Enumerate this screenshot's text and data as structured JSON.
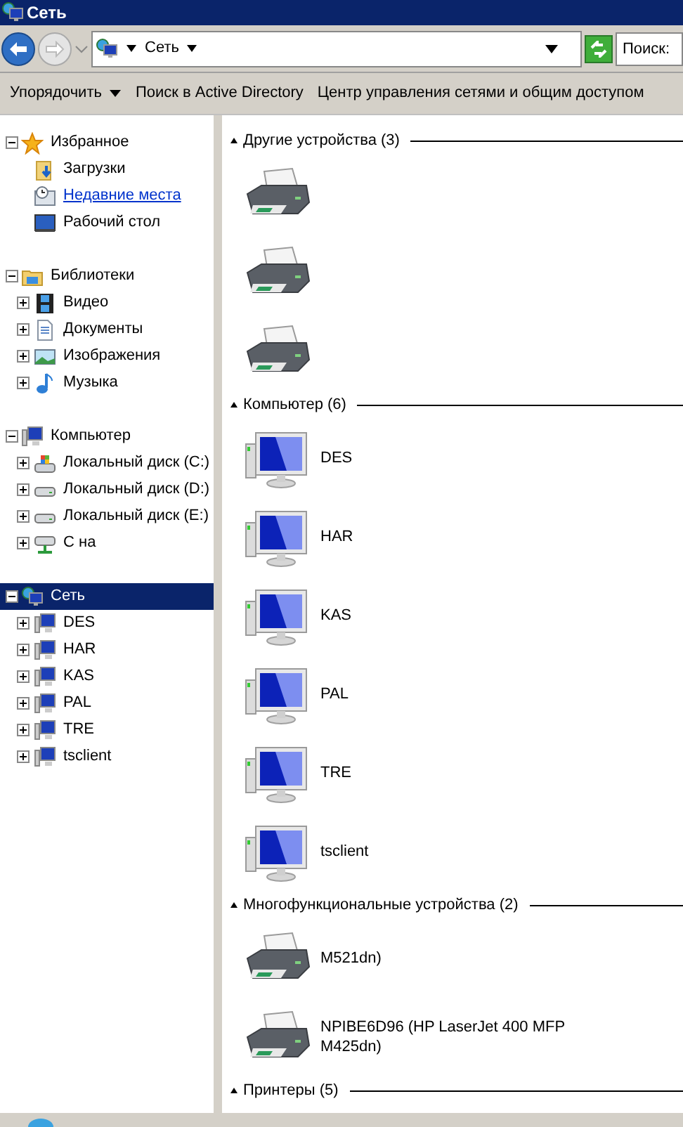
{
  "window": {
    "title": "Сеть"
  },
  "address": {
    "path": "Сеть",
    "search_placeholder": "Поиск:"
  },
  "toolbar": [
    {
      "label": "Упорядочить",
      "dropdown": true
    },
    {
      "label": "Поиск в Active Directory",
      "dropdown": false
    },
    {
      "label": "Центр управления сетями и общим доступом",
      "dropdown": false
    }
  ],
  "sidebar": {
    "groups": [
      {
        "label": "Избранное",
        "kind": "star",
        "expanded": true,
        "selected": false,
        "children": [
          {
            "label": "Загрузки",
            "kind": "downloads",
            "hovered": false
          },
          {
            "label": "Недавние места",
            "kind": "recent",
            "hovered": true
          },
          {
            "label": "Рабочий стол",
            "kind": "desktop",
            "hovered": false
          }
        ]
      },
      {
        "label": "Библиотеки",
        "kind": "library",
        "expanded": true,
        "selected": false,
        "children": [
          {
            "label": "Видео",
            "kind": "film",
            "expanded": false
          },
          {
            "label": "Документы",
            "kind": "document",
            "expanded": false
          },
          {
            "label": "Изображения",
            "kind": "image",
            "expanded": false
          },
          {
            "label": "Музыка",
            "kind": "music",
            "expanded": false
          }
        ]
      },
      {
        "label": "Компьютер",
        "kind": "computer",
        "expanded": true,
        "selected": false,
        "children": [
          {
            "label": "Локальный диск (C:)",
            "kind": "drive-win",
            "expanded": false
          },
          {
            "label": "Локальный диск (D:)",
            "kind": "drive",
            "expanded": false
          },
          {
            "label": "Локальный диск (E:)",
            "kind": "drive",
            "expanded": false
          },
          {
            "label": "С на",
            "kind": "netdrive",
            "expanded": false
          }
        ]
      },
      {
        "label": "Сеть",
        "kind": "network",
        "expanded": true,
        "selected": true,
        "children": [
          {
            "label": "DES",
            "kind": "pc",
            "expanded": false
          },
          {
            "label": "HAR",
            "kind": "pc",
            "expanded": false
          },
          {
            "label": "KAS",
            "kind": "pc",
            "expanded": false
          },
          {
            "label": "PAL",
            "kind": "pc",
            "expanded": false
          },
          {
            "label": "TRE",
            "kind": "pc",
            "expanded": false
          },
          {
            "label": "tsclient",
            "kind": "pc",
            "expanded": false
          }
        ]
      }
    ]
  },
  "content": {
    "groups": [
      {
        "title": "Другие устройства (3)",
        "expanded": true,
        "items": [
          {
            "kind": "printer"
          },
          {
            "kind": "printer"
          },
          {
            "kind": "printer"
          }
        ]
      },
      {
        "title": "Компьютер (6)",
        "expanded": true,
        "items": [
          {
            "kind": "computer",
            "label": "DES"
          },
          {
            "kind": "computer",
            "label": "HAR"
          },
          {
            "kind": "computer",
            "label": "KAS"
          },
          {
            "kind": "computer",
            "label": "PAL"
          },
          {
            "kind": "computer",
            "label": "TRE"
          },
          {
            "kind": "computer",
            "label": "tsclient"
          }
        ]
      },
      {
        "title": "Многофункциональные устройства (2)",
        "expanded": true,
        "items": [
          {
            "kind": "printer",
            "label": "M521dn)"
          },
          {
            "kind": "printer",
            "label": "NPIBE6D96 (HP LaserJet 400 MFP M425dn)"
          }
        ]
      },
      {
        "title": "Принтеры (5)",
        "expanded": true
      }
    ]
  }
}
